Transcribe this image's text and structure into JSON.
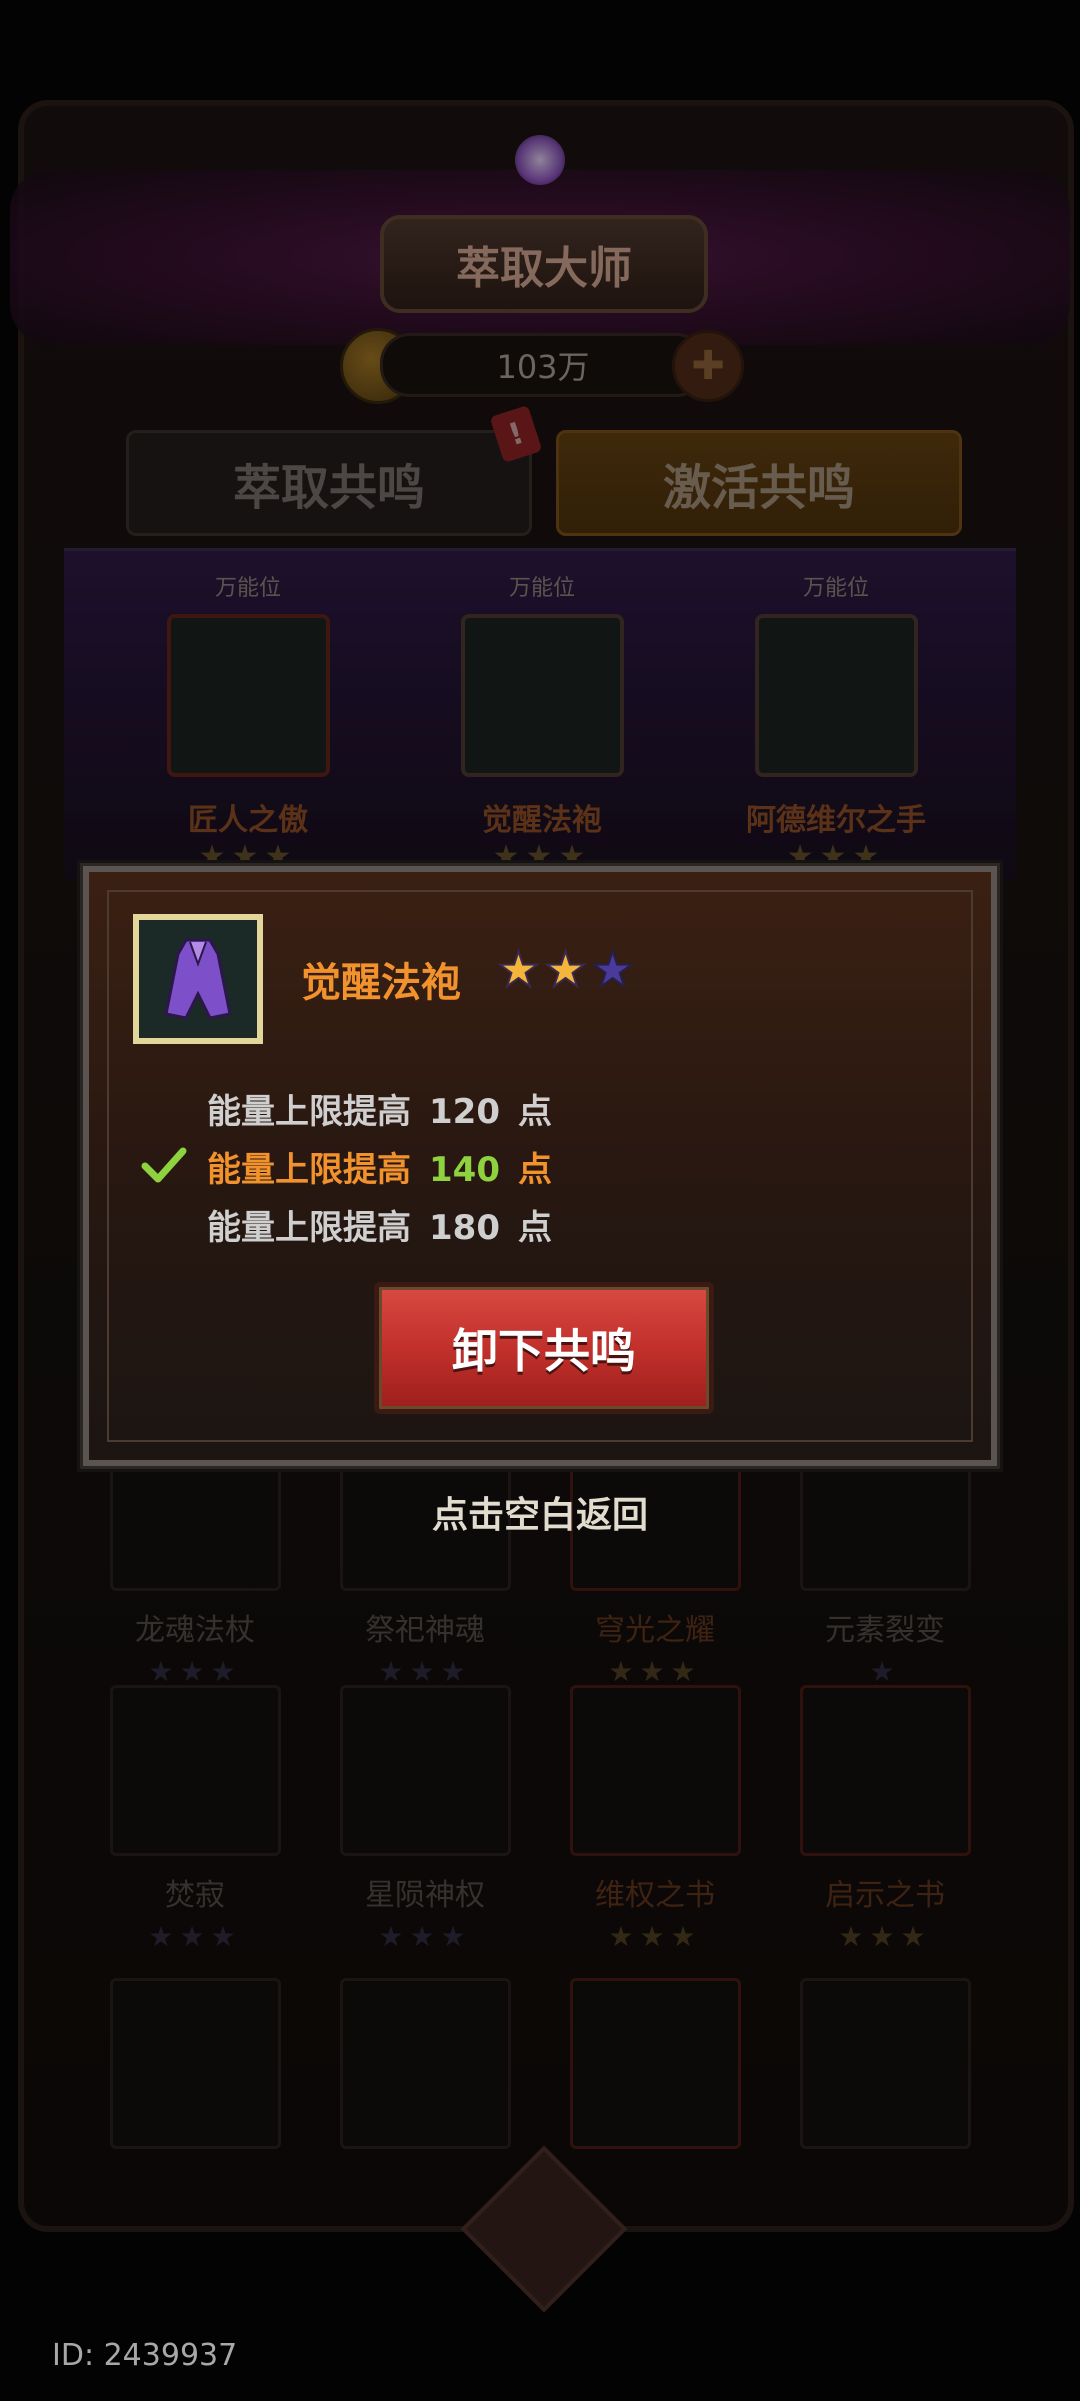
{
  "header": {
    "title": "萃取大师",
    "currency_value": "103万",
    "coin_icon": "coin-icon",
    "add_icon": "plus-icon"
  },
  "tabs": [
    {
      "label": "萃取共鸣"
    },
    {
      "label": "激活共鸣"
    }
  ],
  "badge": "!",
  "slots": [
    {
      "tag": "万能位",
      "name": "匠人之傲",
      "stars": "★★★"
    },
    {
      "tag": "万能位",
      "name": "觉醒法袍",
      "stars": "★★★"
    },
    {
      "tag": "万能位",
      "name": "阿德维尔之手",
      "stars": "★★★"
    }
  ],
  "grid": [
    {
      "name": "龙魂法杖",
      "stars": "★★★"
    },
    {
      "name": "祭祀神魂",
      "stars": "★★★"
    },
    {
      "name": "穹光之耀",
      "stars": "★★★"
    },
    {
      "name": "元素裂变",
      "stars": "★"
    },
    {
      "name": "焚寂",
      "stars": "★★★"
    },
    {
      "name": "星陨神权",
      "stars": "★★★"
    },
    {
      "name": "维权之书",
      "stars": "★★★"
    },
    {
      "name": "启示之书",
      "stars": "★★★"
    }
  ],
  "popup": {
    "item_name": "觉醒法袍",
    "stars_filled": 2,
    "stars_total": 3,
    "effects": [
      {
        "label": "能量上限提高",
        "value": "120",
        "unit": "点"
      },
      {
        "label": "能量上限提高",
        "value": "140",
        "unit": "点"
      },
      {
        "label": "能量上限提高",
        "value": "180",
        "unit": "点"
      }
    ],
    "button_label": "卸下共鸣"
  },
  "hint": "点击空白返回",
  "id_text": "ID: 2439937",
  "colors": {
    "accent_orange": "#f2922d",
    "active_green": "#8ed33f",
    "button_red": "#c2302b"
  }
}
